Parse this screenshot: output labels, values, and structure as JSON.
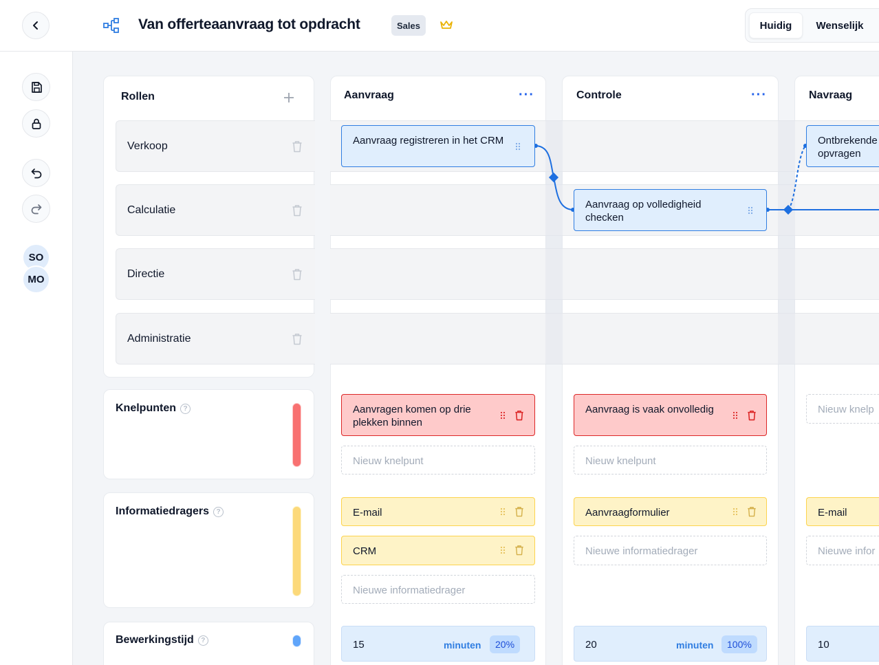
{
  "header": {
    "title": "Van offerteaanvraag tot opdracht",
    "badge": "Sales",
    "view_toggle": {
      "current": "Huidig",
      "desired": "Wenselijk"
    }
  },
  "rail": {
    "avatars": [
      "SO",
      "MO"
    ]
  },
  "roles_panel": {
    "title": "Rollen",
    "roles": [
      "Verkoop",
      "Calculatie",
      "Directie",
      "Administratie"
    ]
  },
  "sections": {
    "pain_points": {
      "title": "Knelpunten",
      "color": "#f87171"
    },
    "info_carriers": {
      "title": "Informatiedragers",
      "color": "#fcd97a"
    },
    "processing_time": {
      "title": "Bewerkingstijd",
      "color": "#60a5fa"
    }
  },
  "columns": [
    {
      "title": "Aanvraag",
      "step": "Aanvraag registreren in het CRM",
      "pain_points": [
        "Aanvragen komen op drie plekken binnen"
      ],
      "pain_placeholder": "Nieuw knelpunt",
      "info_carriers": [
        "E-mail",
        "CRM"
      ],
      "info_placeholder": "Nieuwe informatiedrager",
      "time": {
        "value": "15",
        "unit": "minuten",
        "percent": "20%"
      }
    },
    {
      "title": "Controle",
      "step": "Aanvraag op volledigheid checken",
      "pain_points": [
        "Aanvraag is vaak onvolledig"
      ],
      "pain_placeholder": "Nieuw knelpunt",
      "info_carriers": [
        "Aanvraagformulier"
      ],
      "info_placeholder": "Nieuwe informatiedrager",
      "time": {
        "value": "20",
        "unit": "minuten",
        "percent": "100%"
      }
    },
    {
      "title": "Navraag",
      "step": "Ontbrekende opvragen",
      "pain_placeholder": "Nieuw knelp",
      "info_carriers": [
        "E-mail"
      ],
      "info_placeholder": "Nieuwe infor",
      "time": {
        "value": "10"
      }
    }
  ]
}
